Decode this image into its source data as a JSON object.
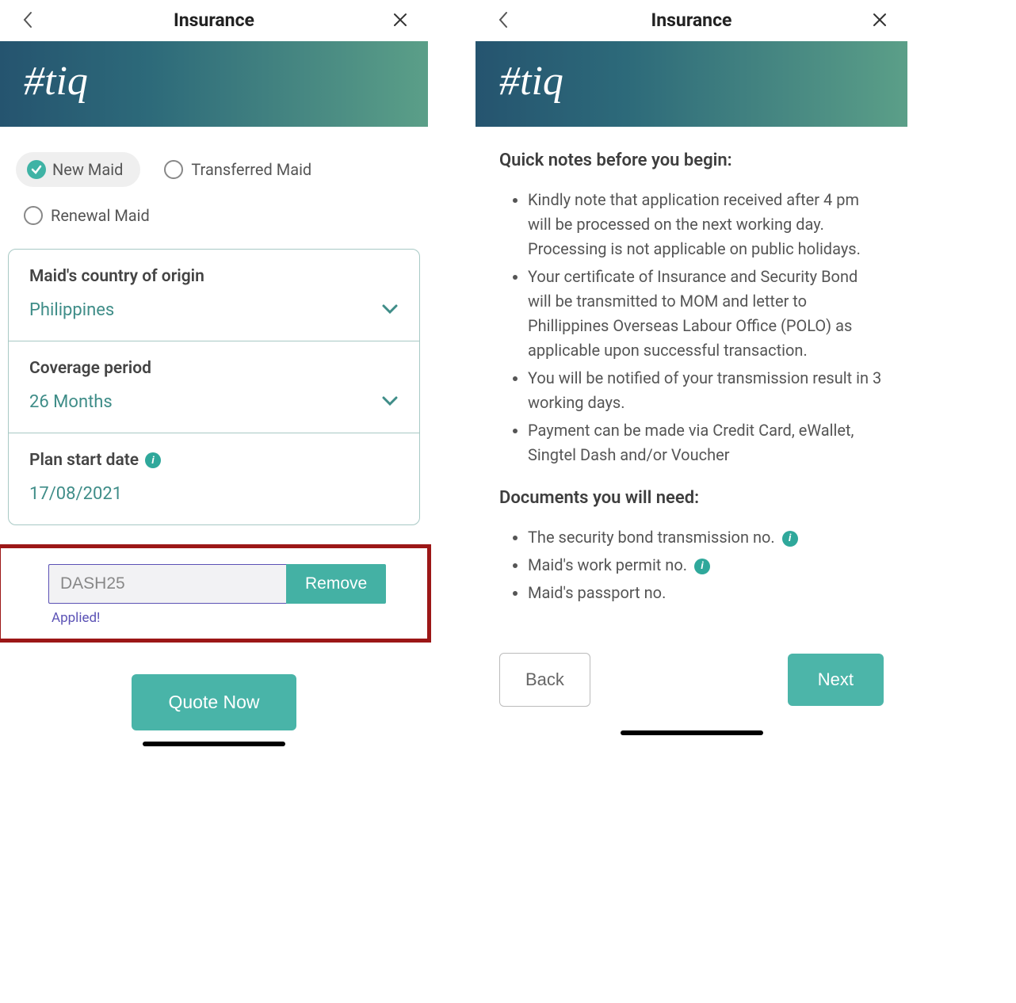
{
  "left": {
    "header": {
      "title": "Insurance"
    },
    "brand": "#tiq",
    "options": {
      "new_maid": "New Maid",
      "transferred_maid": "Transferred Maid",
      "renewal_maid": "Renewal Maid"
    },
    "fields": {
      "origin_label": "Maid's country of origin",
      "origin_value": "Philippines",
      "coverage_label": "Coverage period",
      "coverage_value": "26 Months",
      "start_label": "Plan start date",
      "start_value": "17/08/2021"
    },
    "promo": {
      "code": "DASH25",
      "remove_label": "Remove",
      "applied_text": "Applied!"
    },
    "quote_button": "Quote Now"
  },
  "right": {
    "header": {
      "title": "Insurance"
    },
    "brand": "#tiq",
    "notes_heading": "Quick notes before you begin:",
    "notes": [
      "Kindly note that application received after 4 pm will be processed on the next working day. Processing is not applicable on public holidays.",
      "Your certificate of Insurance and Security Bond will be transmitted to MOM and letter to Phillippines Overseas Labour Office (POLO) as applicable upon successful transaction.",
      "You will be notified of your transmission result in 3 working days.",
      "Payment can be made via Credit Card, eWallet, Singtel Dash and/or Voucher"
    ],
    "docs_heading": "Documents you will need:",
    "docs": [
      "The security bond transmission no.",
      "Maid's work permit no.",
      "Maid's passport no."
    ],
    "back_button": "Back",
    "next_button": "Next"
  }
}
